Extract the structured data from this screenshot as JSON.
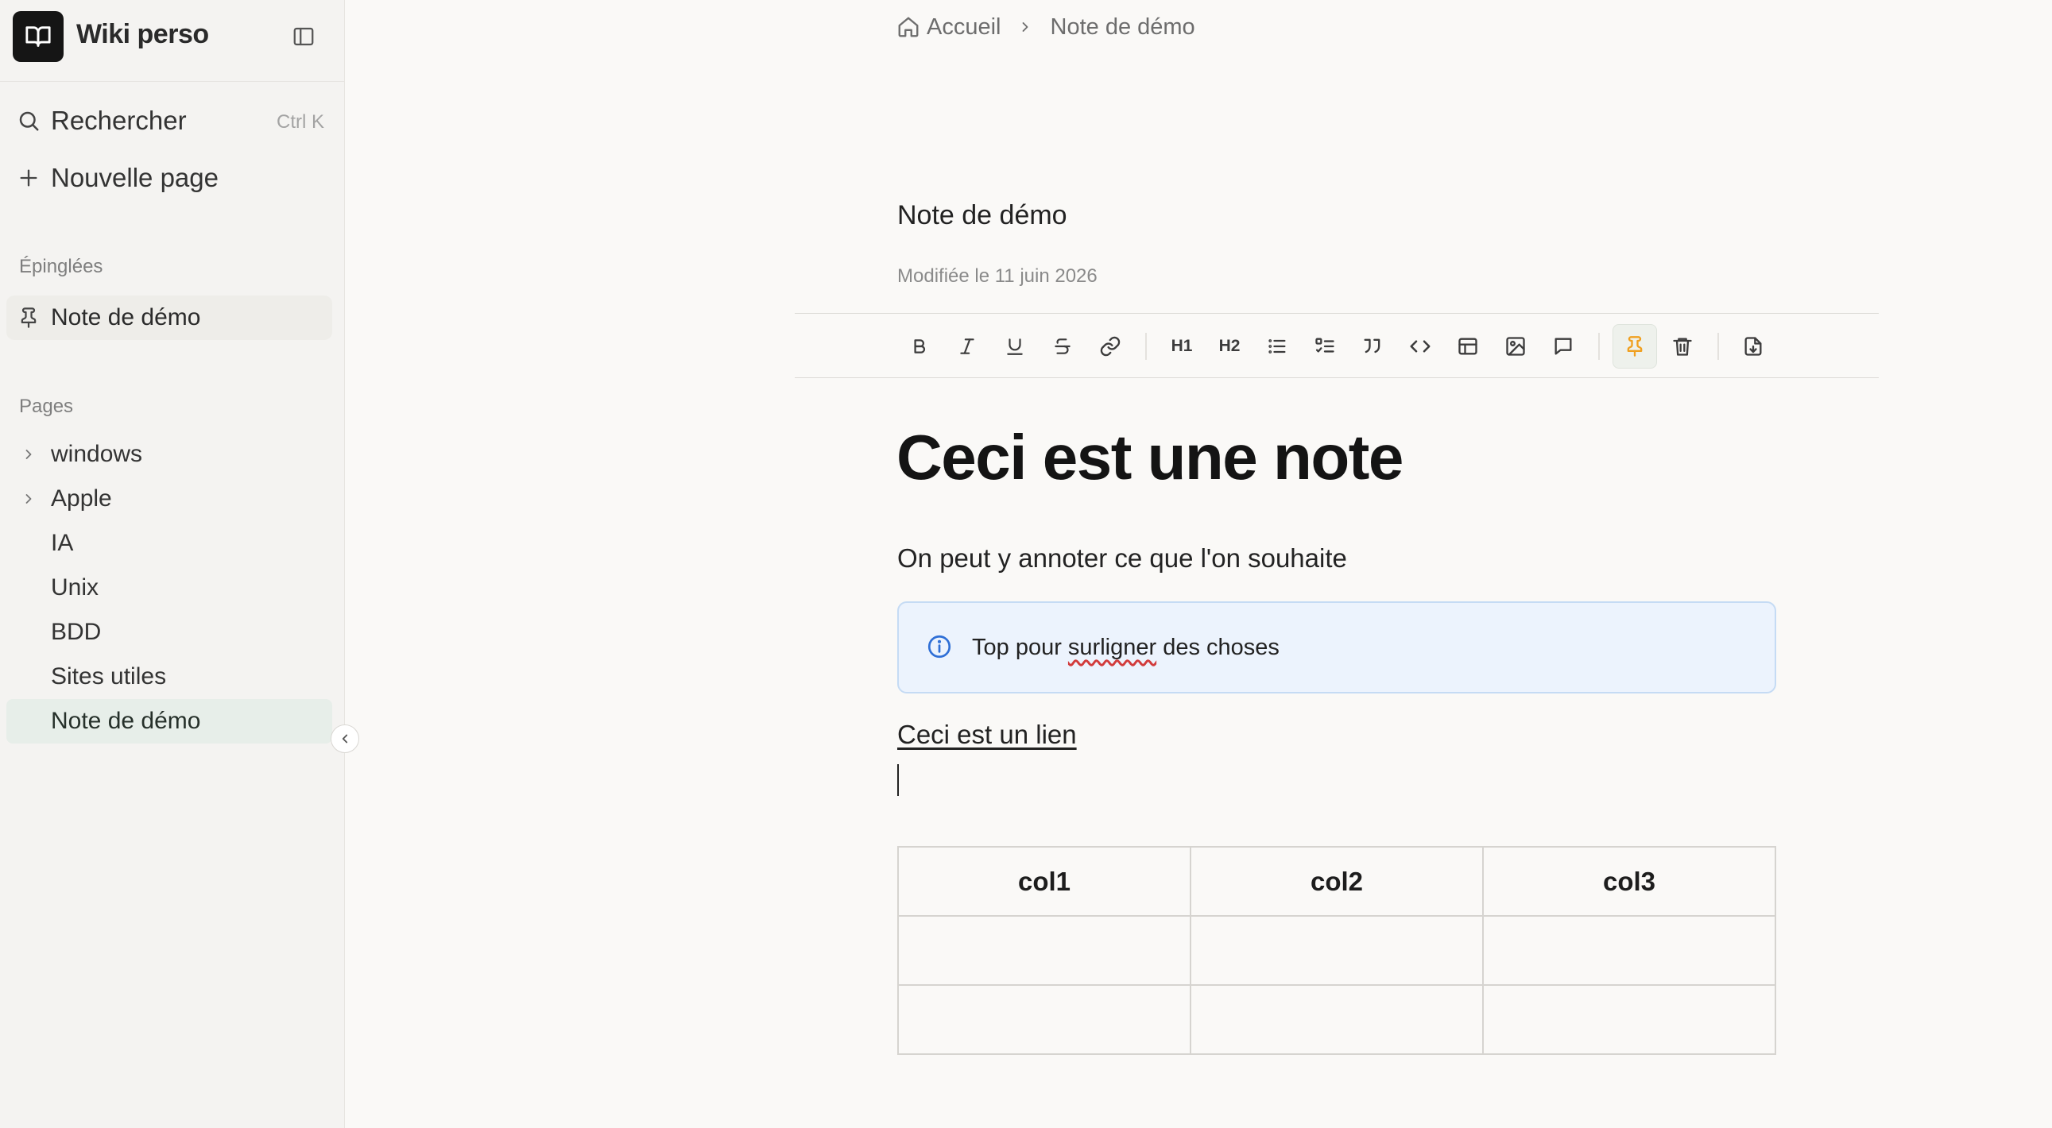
{
  "app": {
    "name": "Wiki perso"
  },
  "sidebar": {
    "search_label": "Rechercher",
    "search_shortcut": "Ctrl K",
    "new_page_label": "Nouvelle page",
    "pinned_section": "Épinglées",
    "pinned_items": [
      {
        "label": "Note de démo",
        "icon": "pin-icon"
      }
    ],
    "pages_section": "Pages",
    "pages": [
      {
        "label": "windows",
        "expandable": true
      },
      {
        "label": "Apple",
        "expandable": true
      },
      {
        "label": "IA",
        "expandable": false
      },
      {
        "label": "Unix",
        "expandable": false
      },
      {
        "label": "BDD",
        "expandable": false
      },
      {
        "label": "Sites utiles",
        "expandable": false
      },
      {
        "label": "Note de démo",
        "expandable": false,
        "active": true
      }
    ]
  },
  "breadcrumb": {
    "home": "Accueil",
    "current": "Note de démo"
  },
  "document": {
    "title": "Note de démo",
    "modified": "Modifiée le 11 juin 2026",
    "heading": "Ceci est une note",
    "paragraph": "On peut y annoter ce que l'on souhaite",
    "callout": {
      "before": "Top pour ",
      "misspelled": "surligner",
      "after": " des choses",
      "icon": "info-icon"
    },
    "link_text": "Ceci est un lien",
    "table": {
      "headers": [
        "col1",
        "col2",
        "col3"
      ],
      "rows": [
        [
          "",
          "",
          ""
        ],
        [
          "",
          "",
          ""
        ]
      ]
    }
  },
  "toolbar": {
    "h1_label": "H1",
    "h2_label": "H2",
    "tools": [
      "bold-icon",
      "italic-icon",
      "underline-icon",
      "strikethrough-icon",
      "link-icon",
      "heading-1-icon",
      "heading-2-icon",
      "bullet-list-icon",
      "task-list-icon",
      "quote-icon",
      "code-icon",
      "table-icon",
      "image-icon",
      "comment-icon",
      "pin-icon",
      "trash-icon",
      "export-icon"
    ],
    "active": "pin-icon"
  },
  "colors": {
    "accent_pin": "#f0a020",
    "callout_bg": "#ecf3fd",
    "callout_border": "#c5dbf4",
    "info_icon": "#2f6fd6",
    "active_page_bg": "#e7eee9"
  }
}
